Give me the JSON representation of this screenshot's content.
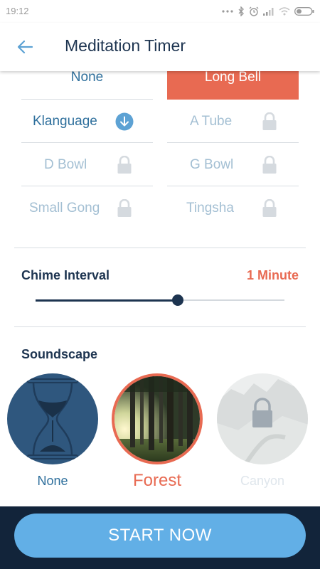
{
  "status_bar": {
    "time": "19:12"
  },
  "header": {
    "title": "Meditation Timer"
  },
  "bells": {
    "items": [
      {
        "label": "None"
      },
      {
        "label": "Long Bell"
      },
      {
        "label": "Klanguage"
      },
      {
        "label": "A Tube"
      },
      {
        "label": "D Bowl"
      },
      {
        "label": "G Bowl"
      },
      {
        "label": "Small Gong"
      },
      {
        "label": "Tingsha"
      }
    ],
    "selected": "Long Bell",
    "downloadable": [
      "Klanguage"
    ],
    "locked": [
      "A Tube",
      "D Bowl",
      "G Bowl",
      "Small Gong",
      "Tingsha"
    ]
  },
  "chime": {
    "title": "Chime Interval",
    "value": "1 Minute",
    "slider_fraction": 0.57
  },
  "soundscape": {
    "title": "Soundscape",
    "items": [
      {
        "label": "None",
        "icon": "hourglass-icon"
      },
      {
        "label": "Forest",
        "selected": true
      },
      {
        "label": "Canyon",
        "locked": true
      }
    ]
  },
  "footer": {
    "start_label": "START NOW"
  },
  "colors": {
    "accent": "#e86a52",
    "navy": "#1d3450",
    "link_blue": "#2e6f9c",
    "light_blue": "#62afe6",
    "muted": "#a3bfd3",
    "lock_gray": "#d5dadf"
  }
}
